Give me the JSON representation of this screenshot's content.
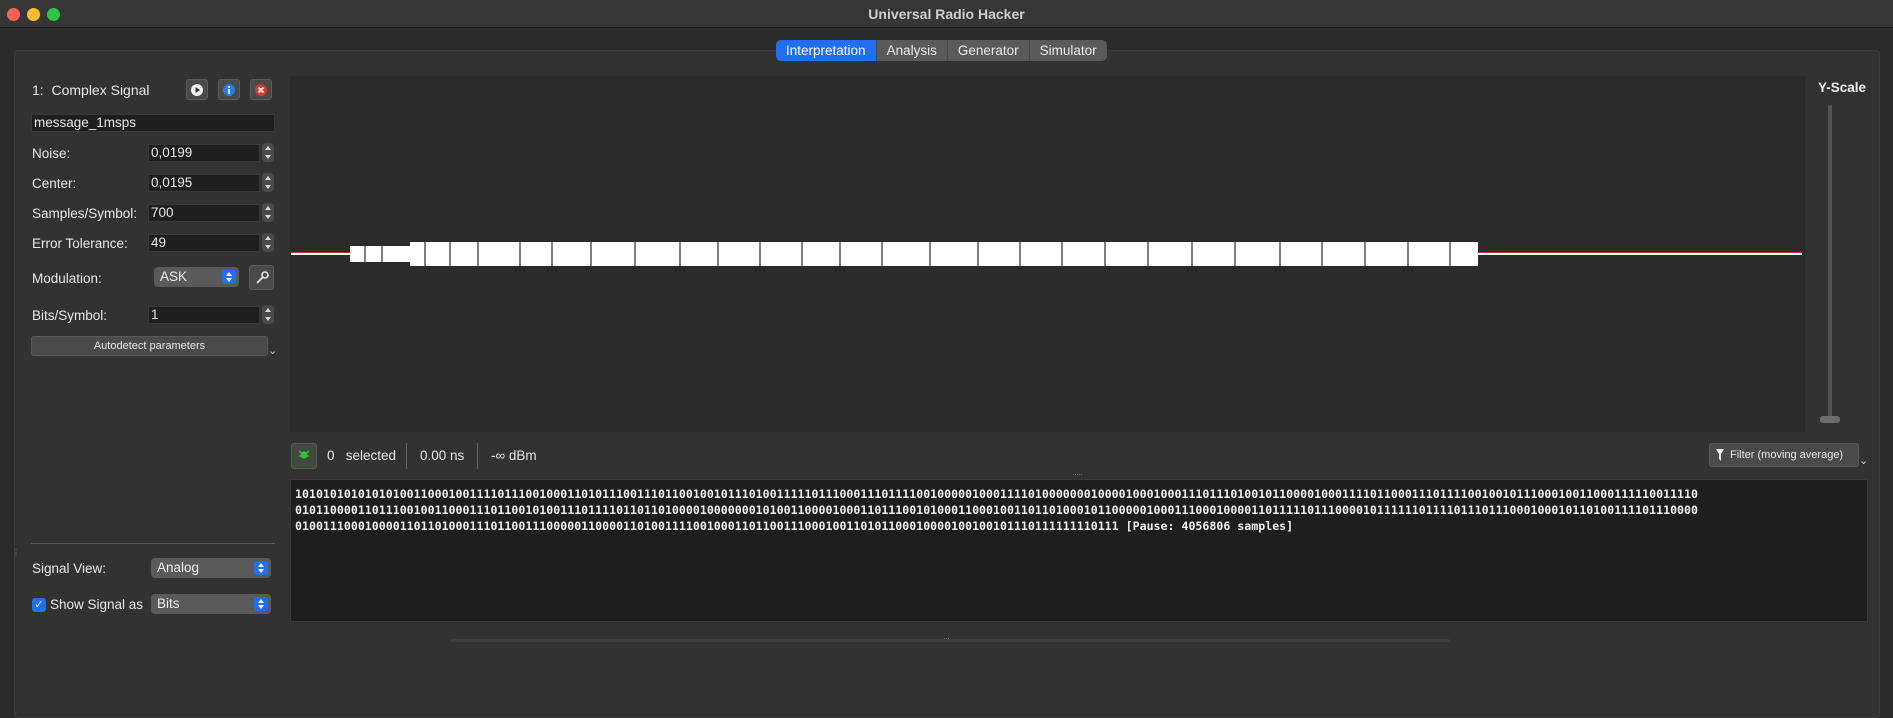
{
  "window": {
    "title": "Universal Radio Hacker"
  },
  "tabs": [
    {
      "label": "Interpretation",
      "active": true
    },
    {
      "label": "Analysis",
      "active": false
    },
    {
      "label": "Generator",
      "active": false
    },
    {
      "label": "Simulator",
      "active": false
    }
  ],
  "signal": {
    "index": "1:",
    "title": "Complex Signal",
    "name": "message_1msps"
  },
  "params": {
    "noise_label": "Noise:",
    "noise_value": "0,0199",
    "center_label": "Center:",
    "center_value": "0,0195",
    "sps_label": "Samples/Symbol:",
    "sps_value": "700",
    "tolerance_label": "Error Tolerance:",
    "tolerance_value": "49",
    "modulation_label": "Modulation:",
    "modulation_value": "ASK",
    "bits_label": "Bits/Symbol:",
    "bits_value": "1",
    "autodetect_label": "Autodetect parameters"
  },
  "view": {
    "signal_view_label": "Signal View:",
    "signal_view_value": "Analog",
    "show_signal_label": "Show Signal as",
    "show_signal_checked": true,
    "show_signal_value": "Bits"
  },
  "yscale": {
    "label": "Y-Scale"
  },
  "status": {
    "selected_count": "0",
    "selected_label": "selected",
    "duration": "0.00 ns",
    "power": "-∞ dBm",
    "filter_label": "Filter (moving average)"
  },
  "bits": {
    "line1": "101010101010101001100010011110111001000110101110011101100100101110100111110111000111011110010000010001111010000000100001000100011101110100101100001000111101100011101111001001011100010011000111110011110",
    "line2": "010110000110111001001100011101100101001110111101101101000010000000101001100001000110111001010001100010011011010001011000001000111000100001101111101110000101111110111101110111000100010110100111101110000",
    "line3": "0100111000100001101101000111011001110000011000011010011110010001101100111000100110101100010000100100101110111111110111 [Pause: 4056806 samples]"
  },
  "colors": {
    "accent": "#1f6ff0",
    "signal": "#ffffff",
    "noise_line": "#e03a3a"
  }
}
